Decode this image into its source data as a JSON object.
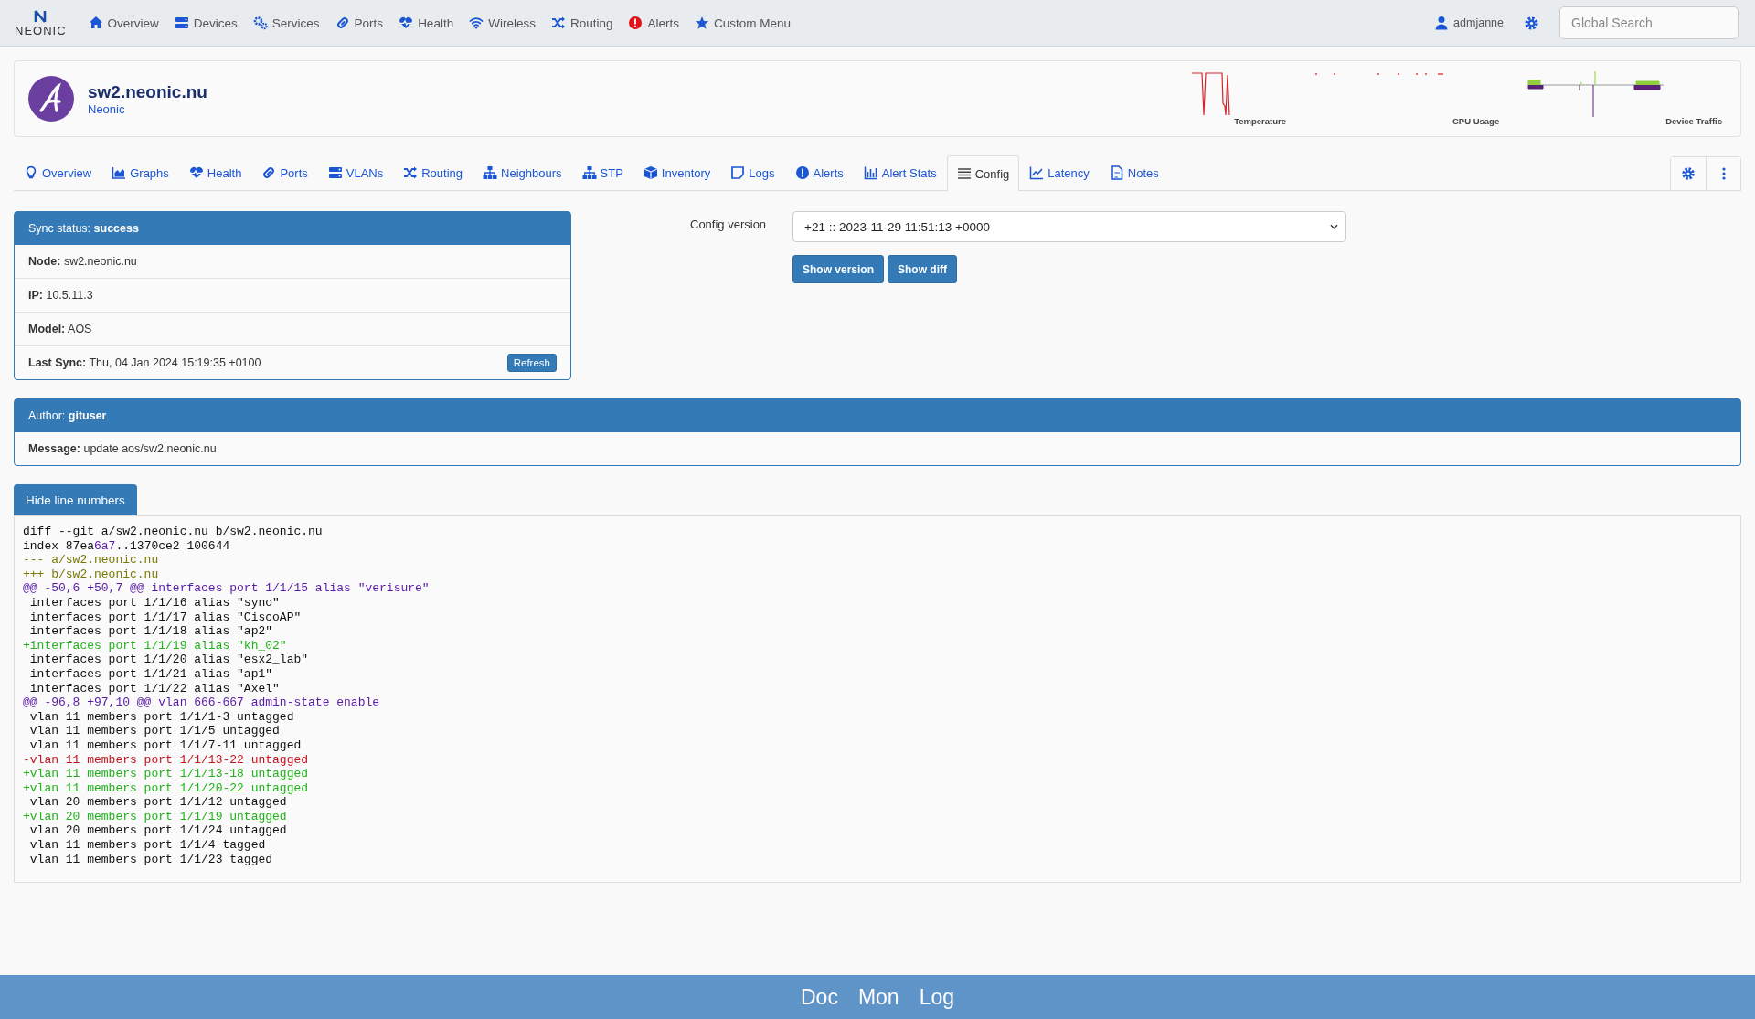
{
  "brand": {
    "name": "NEONIC"
  },
  "nav": [
    {
      "label": "Overview"
    },
    {
      "label": "Devices"
    },
    {
      "label": "Services"
    },
    {
      "label": "Ports"
    },
    {
      "label": "Health"
    },
    {
      "label": "Wireless"
    },
    {
      "label": "Routing"
    },
    {
      "label": "Alerts"
    },
    {
      "label": "Custom Menu"
    }
  ],
  "user": {
    "name": "admjanne"
  },
  "search": {
    "placeholder": "Global Search"
  },
  "device": {
    "hostname": "sw2.neonic.nu",
    "vendor": "Neonic",
    "graphs": [
      {
        "label": "Temperature"
      },
      {
        "label": "CPU Usage"
      },
      {
        "label": "Device Traffic"
      }
    ]
  },
  "tabs": [
    {
      "label": "Overview",
      "selected": false
    },
    {
      "label": "Graphs",
      "selected": false
    },
    {
      "label": "Health",
      "selected": false
    },
    {
      "label": "Ports",
      "selected": false
    },
    {
      "label": "VLANs",
      "selected": false
    },
    {
      "label": "Routing",
      "selected": false
    },
    {
      "label": "Neighbours",
      "selected": false
    },
    {
      "label": "STP",
      "selected": false
    },
    {
      "label": "Inventory",
      "selected": false
    },
    {
      "label": "Logs",
      "selected": false
    },
    {
      "label": "Alerts",
      "selected": false
    },
    {
      "label": "Alert Stats",
      "selected": false
    },
    {
      "label": "Config",
      "selected": true
    },
    {
      "label": "Latency",
      "selected": false
    },
    {
      "label": "Notes",
      "selected": false
    }
  ],
  "sync_panel": {
    "heading": "Sync status: **success**",
    "rows": [
      {
        "text": "**Node:** sw2.neonic.nu"
      },
      {
        "text": "**IP:** 10.5.11.3"
      },
      {
        "text": "**Model:** AOS"
      },
      {
        "text": "**Last Sync:** Thu, 04 Jan 2024 15:19:35 +0100",
        "button": "Refresh"
      }
    ]
  },
  "config_version": {
    "label": "Config version",
    "value": "+21 :: 2023-11-29 11:51:13 +0000",
    "buttons": [
      "Show version",
      "Show diff"
    ]
  },
  "commit_panel": {
    "heading": "Author: **gituser**",
    "message": "**Message:** update aos/sw2.neonic.nu"
  },
  "toggle_button": "Hide line numbers",
  "diff": [
    {
      "kind": "meta",
      "text": "diff --git a/sw2.neonic.nu b/sw2.neonic.nu"
    },
    {
      "kind": "meta",
      "segments": [
        {
          "kind": "meta",
          "text": "index 87ea"
        },
        {
          "kind": "hunk",
          "text": "6a7"
        },
        {
          "kind": "meta",
          "text": "..1370ce2 100644"
        }
      ]
    },
    {
      "kind": "file",
      "text": "--- a/sw2.neonic.nu"
    },
    {
      "kind": "file",
      "text": "+++ b/sw2.neonic.nu"
    },
    {
      "kind": "hunk",
      "text": "@@ -50,6 +50,7 @@ interfaces port 1/1/15 alias \"verisure\""
    },
    {
      "kind": "context",
      "text": " interfaces port 1/1/16 alias \"syno\""
    },
    {
      "kind": "context",
      "text": " interfaces port 1/1/17 alias \"CiscoAP\""
    },
    {
      "kind": "context",
      "text": " interfaces port 1/1/18 alias \"ap2\""
    },
    {
      "kind": "add",
      "text": "+interfaces port 1/1/19 alias \"kh_02\""
    },
    {
      "kind": "context",
      "text": " interfaces port 1/1/20 alias \"esx2_lab\""
    },
    {
      "kind": "context",
      "text": " interfaces port 1/1/21 alias \"ap1\""
    },
    {
      "kind": "context",
      "text": " interfaces port 1/1/22 alias \"Axel\""
    },
    {
      "kind": "hunk",
      "text": "@@ -96,8 +97,10 @@ vlan 666-667 admin-state enable"
    },
    {
      "kind": "context",
      "text": " vlan 11 members port 1/1/1-3 untagged"
    },
    {
      "kind": "context",
      "text": " vlan 11 members port 1/1/5 untagged"
    },
    {
      "kind": "context",
      "text": " vlan 11 members port 1/1/7-11 untagged"
    },
    {
      "kind": "del",
      "text": "-vlan 11 members port 1/1/13-22 untagged"
    },
    {
      "kind": "add",
      "text": "+vlan 11 members port 1/1/13-18 untagged"
    },
    {
      "kind": "add",
      "text": "+vlan 11 members port 1/1/20-22 untagged"
    },
    {
      "kind": "context",
      "text": " vlan 20 members port 1/1/12 untagged"
    },
    {
      "kind": "add",
      "text": "+vlan 20 members port 1/1/19 untagged"
    },
    {
      "kind": "context",
      "text": " vlan 20 members port 1/1/24 untagged"
    },
    {
      "kind": "context",
      "text": " vlan 11 members port 1/1/4 tagged"
    },
    {
      "kind": "context",
      "text": " vlan 11 members port 1/1/23 tagged"
    }
  ],
  "footer": [
    {
      "label": "Doc"
    },
    {
      "label": "Mon"
    },
    {
      "label": "Log"
    }
  ]
}
